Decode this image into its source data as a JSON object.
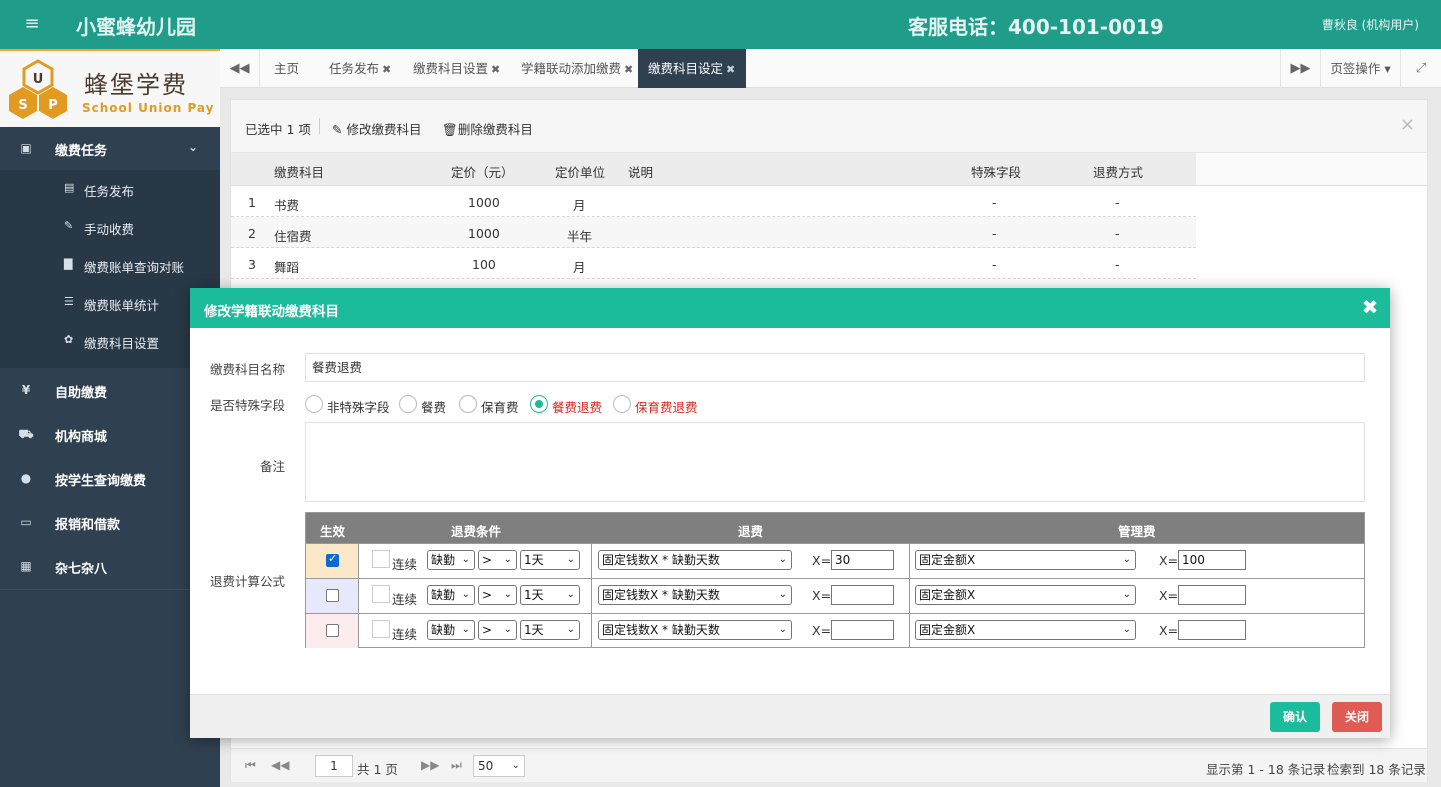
{
  "header": {
    "menu_icon": "hamburger-icon",
    "app_title": "小蜜蜂幼儿园",
    "hotline": "客服电话：400-101-0019",
    "user": "曹秋良 (机构用户)"
  },
  "logo": {
    "cn": "蜂堡学费",
    "en": "School Union Pay"
  },
  "sidebar": {
    "groups": [
      {
        "label": "缴费任务",
        "icon": "money-icon",
        "expanded": true
      },
      {
        "label": "自助缴费",
        "icon": "yen-icon"
      },
      {
        "label": "机构商城",
        "icon": "cart-icon"
      },
      {
        "label": "按学生查询缴费",
        "icon": "user-icon"
      },
      {
        "label": "报销和借款",
        "icon": "card-icon"
      },
      {
        "label": "杂七杂八",
        "icon": "grid-icon"
      }
    ],
    "sub_items": [
      {
        "label": "任务发布",
        "icon": "doc-icon"
      },
      {
        "label": "手动收费",
        "icon": "edit-icon"
      },
      {
        "label": "缴费账单查询对账",
        "icon": "file-icon"
      },
      {
        "label": "缴费账单统计",
        "icon": "list-icon"
      },
      {
        "label": "缴费科目设置",
        "icon": "gear-icon"
      }
    ]
  },
  "tabs": {
    "items": [
      {
        "label": "主页",
        "closable": false
      },
      {
        "label": "任务发布",
        "closable": true
      },
      {
        "label": "缴费科目设置",
        "closable": true
      },
      {
        "label": "学籍联动添加缴费",
        "closable": true
      },
      {
        "label": "缴费科目设定",
        "closable": true,
        "active": true
      }
    ],
    "close_glyph": "✖",
    "ops_label": "页签操作"
  },
  "toolbar": {
    "selected": "已选中 1 项",
    "edit_label": "修改缴费科目",
    "delete_label": "删除缴费科目"
  },
  "grid": {
    "columns": [
      "缴费科目",
      "定价（元）",
      "定价单位",
      "说明",
      "特殊字段",
      "退费方式"
    ],
    "rows": [
      {
        "no": "1",
        "name": "书费",
        "price": "1000",
        "unit": "月",
        "note": "",
        "special": "-",
        "refund": "-"
      },
      {
        "no": "2",
        "name": "住宿费",
        "price": "1000",
        "unit": "半年",
        "note": "",
        "special": "-",
        "refund": "-"
      },
      {
        "no": "3",
        "name": "舞蹈",
        "price": "100",
        "unit": "月",
        "note": "",
        "special": "-",
        "refund": "-"
      }
    ]
  },
  "pager": {
    "page": "1",
    "total_pages": "共 1 页",
    "page_size": "50",
    "showing": "显示第 1 - 18 条记录",
    "found": "检索到 18 条记录"
  },
  "modal": {
    "title": "修改学籍联动缴费科目",
    "name_label": "缴费科目名称",
    "name_value": "餐费退费",
    "special_label": "是否特殊字段",
    "special_options": [
      {
        "label": "非特殊字段",
        "selected": false,
        "red": false
      },
      {
        "label": "餐费",
        "selected": false,
        "red": false
      },
      {
        "label": "保育费",
        "selected": false,
        "red": false
      },
      {
        "label": "餐费退费",
        "selected": true,
        "red": true
      },
      {
        "label": "保育费退费",
        "selected": false,
        "red": true
      }
    ],
    "remark_label": "备注",
    "formula_label": "退费计算公式",
    "formula_headers": {
      "effective": "生效",
      "condition": "退费条件",
      "refund": "退费",
      "fee": "管理费"
    },
    "formula_rows": [
      {
        "effective": true,
        "continuous_label": "连续",
        "cond": "缺勤",
        "op": ">",
        "days": "1天",
        "refund_formula": "固定钱数X * 缺勤天数",
        "x_label": "X=",
        "refund_x": "30",
        "fee_formula": "固定金额X",
        "fee_x": "100",
        "color": "#fbe8c9"
      },
      {
        "effective": false,
        "continuous_label": "连续",
        "cond": "缺勤",
        "op": ">",
        "days": "1天",
        "refund_formula": "固定钱数X * 缺勤天数",
        "x_label": "X=",
        "refund_x": "",
        "fee_formula": "固定金额X",
        "fee_x": "",
        "color": "#e7e8fa"
      },
      {
        "effective": false,
        "continuous_label": "连续",
        "cond": "缺勤",
        "op": ">",
        "days": "1天",
        "refund_formula": "固定钱数X * 缺勤天数",
        "x_label": "X=",
        "refund_x": "",
        "fee_formula": "固定金额X",
        "fee_x": "",
        "color": "#fdeced"
      }
    ],
    "ok_label": "确认",
    "close_label": "关闭"
  }
}
